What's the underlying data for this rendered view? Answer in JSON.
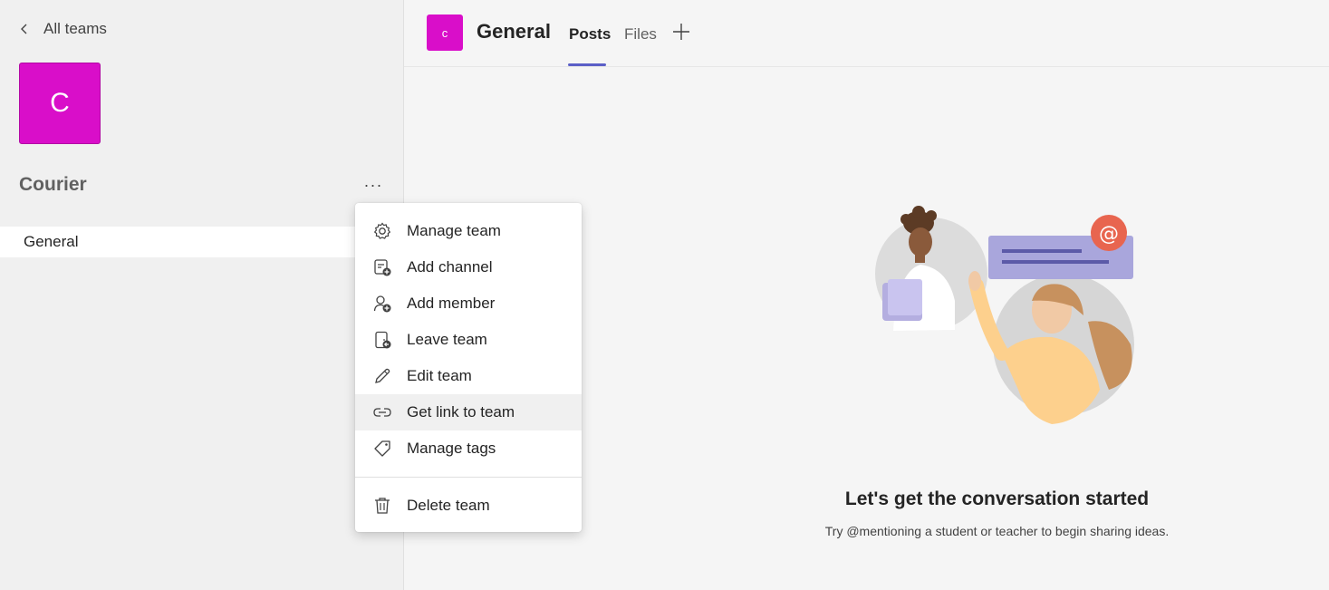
{
  "sidebar": {
    "back_label": "All teams",
    "team_avatar_letter": "C",
    "team_name": "Courier",
    "more_label": "···",
    "channels": [
      {
        "label": "General"
      }
    ]
  },
  "header": {
    "avatar_letter": "c",
    "title": "General",
    "tabs": [
      {
        "label": "Posts",
        "active": true
      },
      {
        "label": "Files",
        "active": false
      }
    ],
    "add_tab_icon": "plus-icon"
  },
  "context_menu": {
    "items": [
      {
        "label": "Manage team",
        "icon": "gear-icon"
      },
      {
        "label": "Add channel",
        "icon": "add-channel-icon"
      },
      {
        "label": "Add member",
        "icon": "add-member-icon"
      },
      {
        "label": "Leave team",
        "icon": "leave-team-icon"
      },
      {
        "label": "Edit team",
        "icon": "pencil-icon"
      },
      {
        "label": "Get link to team",
        "icon": "link-icon",
        "hovered": true
      },
      {
        "label": "Manage tags",
        "icon": "tag-icon"
      }
    ],
    "danger_item": {
      "label": "Delete team",
      "icon": "trash-icon"
    }
  },
  "main": {
    "empty_title": "Let's get the conversation started",
    "empty_subtitle": "Try @mentioning a student or teacher to begin sharing ideas."
  },
  "colors": {
    "team_accent": "#d90ec9",
    "tab_underline": "#5b5fc7",
    "mention_badge": "#e8654f",
    "message_bubble": "#a9a6dc"
  }
}
